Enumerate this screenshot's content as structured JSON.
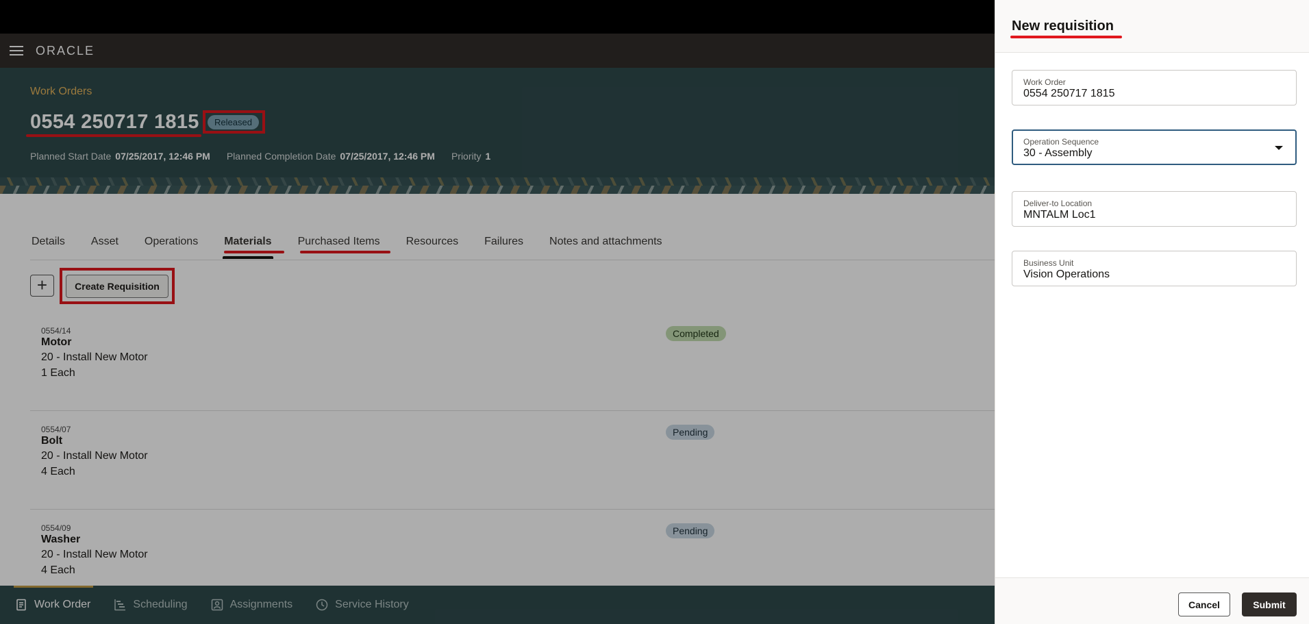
{
  "brand": {
    "logo_text": "ORACLE"
  },
  "header": {
    "breadcrumb": "Work Orders",
    "work_order_number": "0554 250717 1815",
    "status": "Released",
    "meta": [
      {
        "label": "Planned Start Date",
        "value": "07/25/2017, 12:46 PM"
      },
      {
        "label": "Planned Completion Date",
        "value": "07/25/2017, 12:46 PM"
      },
      {
        "label": "Priority",
        "value": "1"
      }
    ]
  },
  "tabs": [
    "Details",
    "Asset",
    "Operations",
    "Materials",
    "Purchased Items",
    "Resources",
    "Failures",
    "Notes and attachments"
  ],
  "active_tab": "Materials",
  "toolbar": {
    "add_label": "+",
    "create_requisition_label": "Create Requisition"
  },
  "materials": [
    {
      "code": "0554/14",
      "name": "Motor",
      "operation": "20 - Install New Motor",
      "quantity": "1 Each",
      "status": "Completed"
    },
    {
      "code": "0554/07",
      "name": "Bolt",
      "operation": "20 - Install New Motor",
      "quantity": "4 Each",
      "status": "Pending"
    },
    {
      "code": "0554/09",
      "name": "Washer",
      "operation": "20 - Install New Motor",
      "quantity": "4 Each",
      "status": "Pending"
    }
  ],
  "bottom_nav": [
    {
      "label": "Work Order",
      "icon": "document-icon",
      "active": true
    },
    {
      "label": "Scheduling",
      "icon": "gantt-icon",
      "active": false
    },
    {
      "label": "Assignments",
      "icon": "person-badge-icon",
      "active": false
    },
    {
      "label": "Service History",
      "icon": "clock-icon",
      "active": false
    }
  ],
  "drawer": {
    "title": "New requisition",
    "fields": [
      {
        "label": "Work Order",
        "value": "0554 250717 1815"
      },
      {
        "label": "Operation Sequence",
        "value": "30 - Assembly"
      },
      {
        "label": "Deliver-to Location",
        "value": "MNTALM Loc1"
      },
      {
        "label": "Business Unit",
        "value": "Vision Operations"
      }
    ],
    "cancel_label": "Cancel",
    "submit_label": "Submit"
  },
  "colors": {
    "brand_bar": "#312d2a",
    "hero": "#2f4a4c",
    "highlight": "#e0181e",
    "breadcrumb": "#e4b35a"
  }
}
